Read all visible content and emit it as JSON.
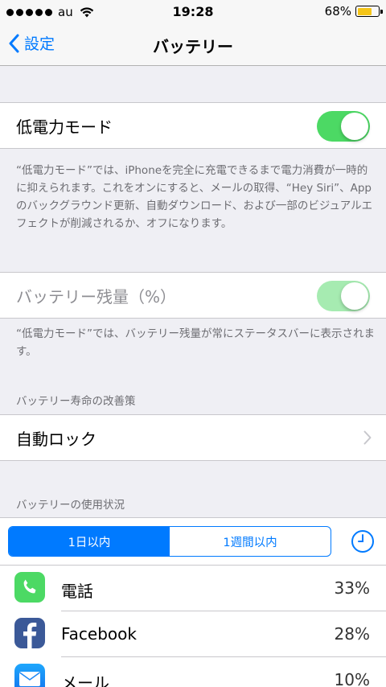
{
  "status_bar": {
    "carrier": "au",
    "time": "19:28",
    "battery_percent": "68%",
    "battery_level": 0.68
  },
  "nav": {
    "back_label": "設定",
    "title": "バッテリー"
  },
  "low_power": {
    "label": "低電力モード",
    "on": true,
    "description": "“低電力モード”では、iPhoneを完全に充電できるまで電力消費が一時的に抑えられます。これをオンにすると、メールの取得、“Hey Siri”、Appのバックグラウンド更新、自動ダウンロード、および一部のビジュアルエフェクトが削減されるか、オフになります。"
  },
  "battery_percentage": {
    "label": "バッテリー残量（%）",
    "on": true,
    "enabled": false,
    "description": "“低電力モード”では、バッテリー残量が常にステータスバーに表示されます。"
  },
  "battery_life": {
    "header": "バッテリー寿命の改善策",
    "auto_lock_label": "自動ロック"
  },
  "usage": {
    "header": "バッテリーの使用状況",
    "tabs": [
      "1日以内",
      "1週間以内"
    ],
    "selected_tab": 0,
    "apps": [
      {
        "name": "電話",
        "percent": "33%",
        "icon": "phone-icon",
        "color": "#4cd964"
      },
      {
        "name": "Facebook",
        "percent": "28%",
        "icon": "facebook-icon",
        "color": "#3b5998"
      },
      {
        "name": "メール",
        "percent": "10%",
        "icon": "mail-icon",
        "color": "#1e88f5"
      }
    ]
  },
  "colors": {
    "accent": "#007aff",
    "toggle_on": "#4cd964",
    "battery_fill": "#f5c518"
  }
}
